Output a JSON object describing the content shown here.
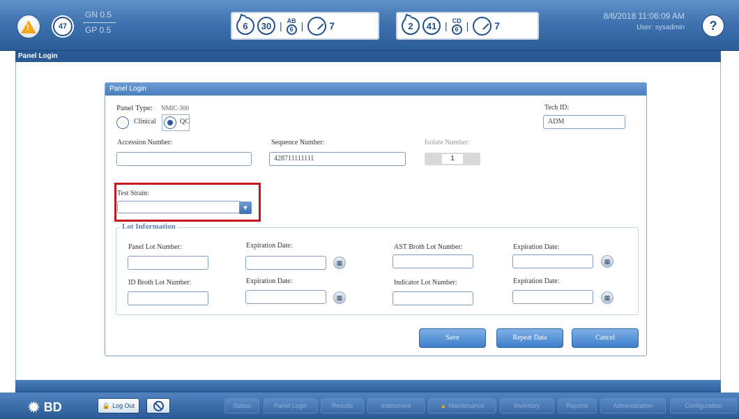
{
  "topbar": {
    "panel_count": "47",
    "gn_label": "GN 0.5",
    "gp_label": "GP 0.5",
    "group1": {
      "ring1": "6",
      "ring2": "30",
      "stacked_top": "AB",
      "stacked_bottom": "6",
      "gauge_value": "7"
    },
    "group2": {
      "ring1": "2",
      "ring2": "41",
      "stacked_top": "CD",
      "stacked_bottom": "6",
      "gauge_value": "7"
    },
    "datetime": "8/6/2018 11:08:09 AM",
    "user": "User: sysadmin",
    "help_glyph": "?"
  },
  "window": {
    "title": "Panel Login"
  },
  "dialog": {
    "title": "Panel Login",
    "panel_type_label": "Panel Type:",
    "panel_type_value": "NMIC-300",
    "radio_clinical": "Clinical",
    "radio_qc": "QC",
    "selected_radio": "QC",
    "tech_id_label": "Tech ID:",
    "tech_id_value": "ADM",
    "accession_label": "Accession Number:",
    "accession_value": "",
    "sequence_label": "Sequence Number:",
    "sequence_value": "428711111111",
    "isolate_label": "Isolate Number:",
    "isolate_value": "1",
    "test_strain_label": "Test Strain:",
    "test_strain_value": "",
    "lot_info_label": "Lot Information",
    "panel_lot_label": "Panel Lot Number:",
    "exp_date_label": "Expiration Date:",
    "ast_broth_label": "AST Broth Lot Number:",
    "id_broth_label": "ID Broth Lot Number:",
    "indicator_label": "Indicator Lot Number:",
    "save_label": "Save",
    "repeat_label": "Repeat Data",
    "cancel_label": "Cancel"
  },
  "footer": {
    "logo_text": "BD",
    "logout_label": "Log Out",
    "nav_items": [
      "Status",
      "Panel Login",
      "Results",
      "Instrument",
      "Maintenance",
      "Inventory",
      "Reports",
      "Administration",
      "Configuration"
    ]
  },
  "colors": {
    "primary": "#2c5c98",
    "highlight": "#c2181e",
    "alert": "#f4a81a"
  }
}
